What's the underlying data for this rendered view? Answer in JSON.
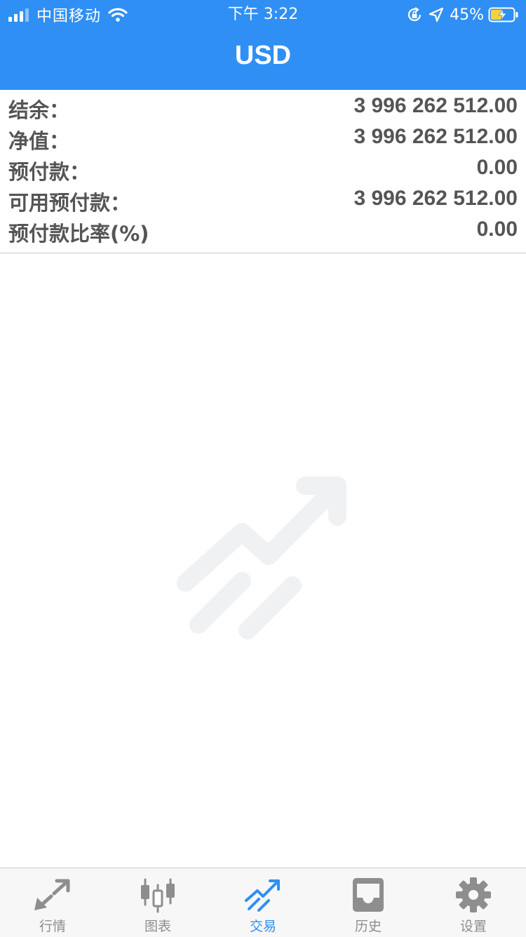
{
  "status_bar": {
    "carrier": "中国移动",
    "time": "下午 3:22",
    "battery_percent": "45%"
  },
  "header": {
    "title": "USD"
  },
  "summary": {
    "rows": [
      {
        "label": "结余：",
        "value": "3 996 262 512.00"
      },
      {
        "label": "净值：",
        "value": "3 996 262 512.00"
      },
      {
        "label": "预付款：",
        "value": "0.00"
      },
      {
        "label": "可用预付款：",
        "value": "3 996 262 512.00"
      },
      {
        "label": "预付款比率(%)",
        "value": "0.00"
      }
    ]
  },
  "tabbar": {
    "tabs": [
      {
        "label": "行情",
        "icon": "quotes-arrows-icon"
      },
      {
        "label": "图表",
        "icon": "candlestick-chart-icon"
      },
      {
        "label": "交易",
        "icon": "trade-trend-icon",
        "active": true
      },
      {
        "label": "历史",
        "icon": "inbox-history-icon"
      },
      {
        "label": "设置",
        "icon": "gear-icon"
      }
    ]
  },
  "colors": {
    "accent": "#2f8ff4",
    "text": "#555555",
    "tab_inactive": "#8e8e8e",
    "watermark": "#f1f2f4"
  }
}
